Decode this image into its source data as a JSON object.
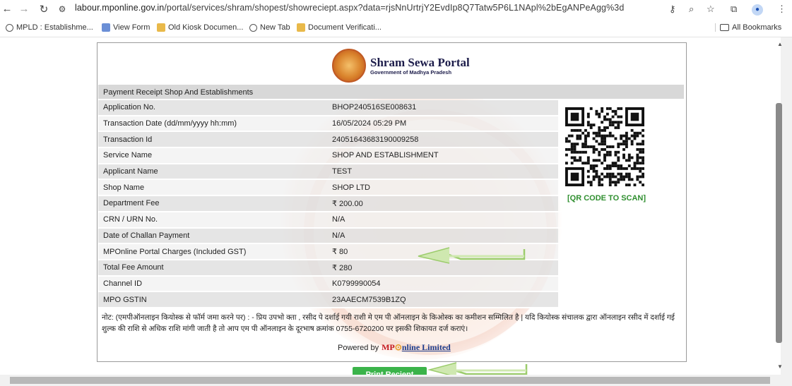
{
  "browser": {
    "url_host": "labour.mponline.gov.in",
    "url_path": "/portal/services/shram/shopest/showreciept.aspx?data=rjsNnUrtrjY2EvdIp8Q7Tatw5P6L1NApl%2bEgANPeAgg%3d",
    "bookmarks": [
      "MPLD : Establishme...",
      "View Form",
      "Old Kiosk Documen...",
      "New Tab",
      "Document Verificati..."
    ],
    "all_bookmarks": "All Bookmarks"
  },
  "header": {
    "title": "Shram Sewa Portal",
    "subtitle": "Government of Madhya Pradesh"
  },
  "receipt": {
    "section_title": "Payment Receipt Shop And Establishments",
    "rows": [
      {
        "label": "Application No.",
        "value": "BHOP240516SE008631"
      },
      {
        "label": "Transaction Date (dd/mm/yyyy hh:mm)",
        "value": "16/05/2024 05:29 PM"
      },
      {
        "label": "Transaction Id",
        "value": "24051643683190009258"
      },
      {
        "label": "Service Name",
        "value": "SHOP AND ESTABLISHMENT"
      },
      {
        "label": "Applicant Name",
        "value": "TEST"
      },
      {
        "label": "Shop Name",
        "value": "SHOP LTD"
      },
      {
        "label": "Department Fee",
        "value": "₹ 200.00"
      },
      {
        "label": "CRN / URN No.",
        "value": "N/A"
      },
      {
        "label": "Date of Challan Payment",
        "value": "N/A"
      },
      {
        "label": "MPOnline Portal Charges (Included GST)",
        "value": "₹ 80"
      },
      {
        "label": "Total Fee Amount",
        "value": "₹ 280"
      },
      {
        "label": "Channel ID",
        "value": "K0799990054"
      },
      {
        "label": "MPO GSTIN",
        "value": "23AAECM7539B1ZQ"
      }
    ],
    "qr_caption": "[QR CODE TO SCAN]",
    "note": "नोट: (एमपीऑनलाइन कियोस्क से फॉर्म जमा करने पर) : - प्रिय उपभो क्ता , रसीद पे दर्शाई गयी राशी मे एम पी ऑनलाइन के किओस्क का कमीशन सम्मिलित है | यदि कियोस्क संचालक द्वारा ऑनलाइन रसीद में दर्शाई गई शुल्क की राशि से अधिक राशि मांगी जाती है तो आप एम पी ऑनलाइन के दूरभाष क्रमांक 0755-6720200 पर इसकी शिकायत दर्ज कराएं।",
    "powered_by": "Powered by",
    "mpo_brand_a": "MP",
    "mpo_brand_b": "nline Limited",
    "print_button": "Print Reciept"
  },
  "colors": {
    "qr_caption": "#2f8f2f",
    "print_button": "#3bb34a",
    "annotation_arrow": "#9ccc6c"
  }
}
